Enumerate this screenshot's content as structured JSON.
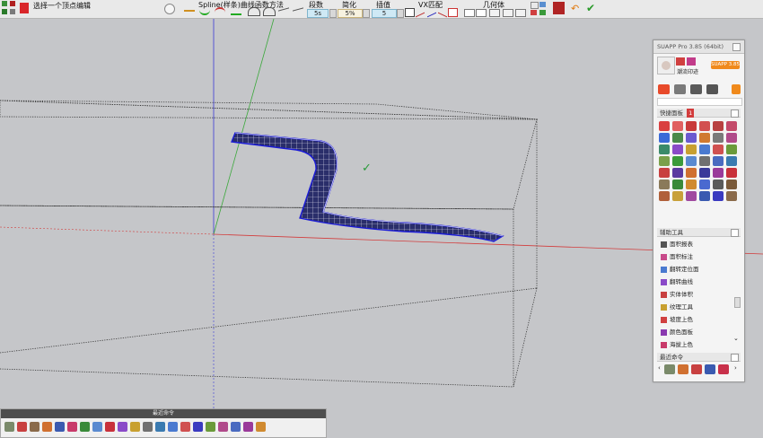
{
  "toolbar": {
    "status_text": "选择一个顶点编辑",
    "spline_title": "Spline(样条)曲线函数方法",
    "segments_label": "段数",
    "segments_value": "5s",
    "simplify_label": "简化",
    "simplify_value": "5%",
    "interp_label": "插值",
    "interp_value": "5",
    "vx_label": "VX匹配",
    "geometry_label": "几何体"
  },
  "suapp": {
    "title": "SUAPP Pro 3.85 (64bit)",
    "user_name": "SUAPP",
    "user_sub": "潮流印迹",
    "badge": "SUAPP 3.85",
    "quick_panel_label": "快捷面板",
    "quick_panel_count": "1",
    "aux_tools_label": "辅助工具",
    "aux_tools": [
      "面积报表",
      "面积标注",
      "翻转定位面",
      "翻转曲线",
      "实体体积",
      "纹理工具",
      "坡度上色",
      "颜色面板",
      "海拔上色"
    ],
    "recent_label": "最近命令"
  },
  "bottom_panel": {
    "title": "最近命令"
  },
  "colors": {
    "canvas": "#c5c6c9",
    "axis_red": "#d23c3c",
    "axis_green": "#3aa83a",
    "axis_blue": "#3a3ad8",
    "surface_edge": "#1b1bd6",
    "accent_orange": "#f08a1c"
  }
}
